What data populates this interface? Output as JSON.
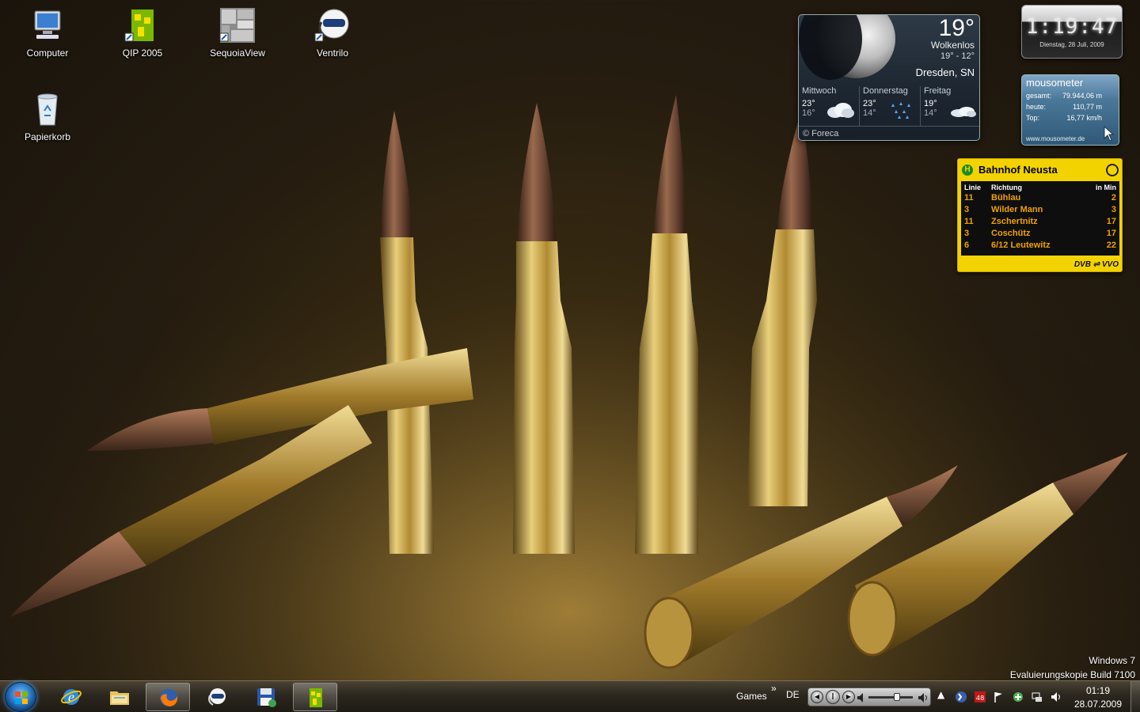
{
  "desktop": {
    "icons": [
      {
        "label": "Computer",
        "icon": "computer-icon"
      },
      {
        "label": "QIP 2005",
        "icon": "qip-icon"
      },
      {
        "label": "SequoiaView",
        "icon": "sequoiaview-icon"
      },
      {
        "label": "Ventrilo",
        "icon": "ventrilo-icon"
      },
      {
        "label": "Papierkorb",
        "icon": "recycle-bin-icon"
      }
    ],
    "watermark": {
      "line1": "Windows 7",
      "line2": "Evaluierungskopie Build 7100"
    }
  },
  "gadgets": {
    "clock": {
      "time": "1:19:47",
      "date": "Dienstag, 28 Juli, 2009"
    },
    "weather": {
      "temperature": "19°",
      "condition": "Wolkenlos",
      "range": "19°  -  12°",
      "location": "Dresden, SN",
      "forecast": [
        {
          "day": "Mittwoch",
          "high": "23°",
          "low": "16°",
          "icon": "cloudy-icon"
        },
        {
          "day": "Donnerstag",
          "high": "23°",
          "low": "14°",
          "icon": "rain-icon"
        },
        {
          "day": "Freitag",
          "high": "19°",
          "low": "14°",
          "icon": "partly-cloudy-icon"
        }
      ],
      "credit": "© Foreca"
    },
    "mousometer": {
      "title": "mousometer",
      "rows": [
        {
          "label": "gesamt:",
          "value": "79.944,06 m"
        },
        {
          "label": "heute:",
          "value": "110,77 m"
        },
        {
          "label": "Top:",
          "value": "16,77 km/h"
        }
      ],
      "url": "www.mousometer.de"
    },
    "dvb": {
      "stop": "Bahnhof Neusta",
      "headers": {
        "line": "Linie",
        "direction": "Richtung",
        "minutes": "in Min"
      },
      "departures": [
        {
          "line": "11",
          "direction": "Bühlau",
          "minutes": "2"
        },
        {
          "line": "3",
          "direction": "Wilder Mann",
          "minutes": "3"
        },
        {
          "line": "11",
          "direction": "Zschertnitz",
          "minutes": "17"
        },
        {
          "line": "3",
          "direction": "Coschütz",
          "minutes": "17"
        },
        {
          "line": "6",
          "direction": "6/12 Leutewitz",
          "minutes": "22"
        }
      ],
      "footer": "DVB ⇌ VVO"
    }
  },
  "taskbar": {
    "pinned": [
      {
        "name": "internet-explorer",
        "active": false
      },
      {
        "name": "windows-explorer",
        "active": false
      },
      {
        "name": "firefox",
        "active": true
      },
      {
        "name": "ventrilo",
        "active": false
      },
      {
        "name": "save-program",
        "active": false
      },
      {
        "name": "qip",
        "active": true
      }
    ],
    "toolbar_label": "Games",
    "toolbar_chevron": "»",
    "language": "DE",
    "tray_up_arrow": "▲",
    "time": "01:19",
    "date": "28.07.2009",
    "volume_level": 0.65
  }
}
